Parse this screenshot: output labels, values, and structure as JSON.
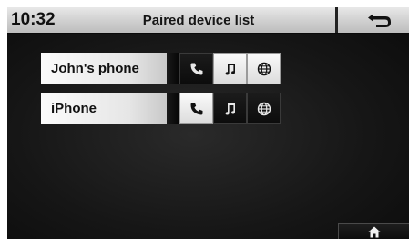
{
  "header": {
    "clock": "10:32",
    "title": "Paired device list",
    "back_icon": "back-arrow-icon"
  },
  "devices": [
    {
      "name": "John's phone",
      "phone": {
        "icon": "phone-icon",
        "active": false
      },
      "music": {
        "icon": "music-note-icon",
        "active": true
      },
      "internet": {
        "icon": "globe-icon",
        "active": true
      }
    },
    {
      "name": "iPhone",
      "phone": {
        "icon": "phone-icon",
        "active": true
      },
      "music": {
        "icon": "music-note-icon",
        "active": false
      },
      "internet": {
        "icon": "globe-icon",
        "active": false
      }
    }
  ],
  "footer": {
    "home_icon": "home-icon"
  },
  "colors": {
    "active_bg": "#f0f0f0",
    "inactive_bg": "#141414",
    "titlebar": "#d4d4d4"
  }
}
